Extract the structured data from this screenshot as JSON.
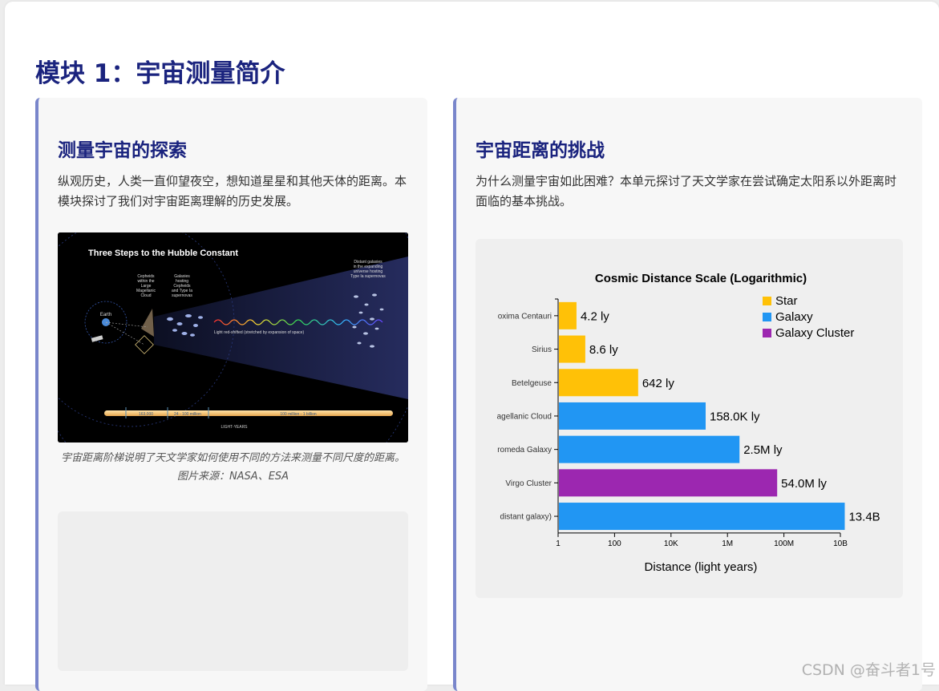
{
  "page": {
    "title": "模块 1：宇宙测量简介"
  },
  "left_card": {
    "title": "测量宇宙的探索",
    "text": "纵观历史，人类一直仰望夜空，想知道星星和其他天体的距离。本模块探讨了我们对宇宙距离理解的历史发展。",
    "image": {
      "heading": "Three Steps to the Hubble Constant",
      "label_earth": "Earth",
      "label_cepheids": [
        "Cepheids",
        "within the",
        "Large",
        "Magellanic",
        "Cloud"
      ],
      "label_galaxies": [
        "Galaxies",
        "hosting",
        "Cepheids",
        "and Type Ia",
        "supernovas"
      ],
      "label_distant": [
        "Distant galaxies",
        "in the expanding",
        "universe hosting",
        "Type Ia supernovas"
      ],
      "label_redshift": "Light red-shifted (stretched by expansion of space)",
      "scale_1": "163,000",
      "scale_2": "24 - 100 million",
      "scale_3": "100 million - 1 billion",
      "scale_units": "LIGHT-YEARS",
      "colors": {
        "background": "#000000",
        "beam": "#1f2553",
        "scale_bar": "#f3c27a"
      }
    },
    "caption": "宇宙距离阶梯说明了天文学家如何使用不同的方法来测量不同尺度的距离。图片来源：NASA、ESA"
  },
  "right_card": {
    "title": "宇宙距离的挑战",
    "text": "为什么测量宇宙如此困难？本单元探讨了天文学家在尝试确定太阳系以外距离时面临的基本挑战。"
  },
  "chart_data": {
    "type": "bar",
    "orientation": "horizontal",
    "title": "Cosmic Distance Scale (Logarithmic)",
    "xlabel": "Distance (light years)",
    "ylabel": "",
    "x_scale": "log",
    "xlim": [
      1,
      10000000000
    ],
    "x_ticks": [
      1,
      100,
      10000,
      1000000,
      100000000,
      10000000000
    ],
    "x_tick_labels": [
      "1",
      "100",
      "10K",
      "1M",
      "100M",
      "10B"
    ],
    "legend_position": "top-right",
    "legend": [
      {
        "name": "Star",
        "color": "#ffc107"
      },
      {
        "name": "Galaxy",
        "color": "#2196f3"
      },
      {
        "name": "Galaxy Cluster",
        "color": "#9c27b0"
      }
    ],
    "categories": [
      "oxima Centauri",
      "Sirius",
      "Betelgeuse",
      "agellanic Cloud",
      "romeda Galaxy",
      "Virgo Cluster",
      "distant galaxy)"
    ],
    "values": [
      4.2,
      8.6,
      642,
      158000,
      2500000,
      54000000,
      13400000000
    ],
    "value_labels": [
      "4.2 ly",
      "8.6 ly",
      "642 ly",
      "158.0K ly",
      "2.5M ly",
      "54.0M ly",
      "13.4B"
    ],
    "types": [
      "Star",
      "Star",
      "Star",
      "Galaxy",
      "Galaxy",
      "Galaxy Cluster",
      "Galaxy"
    ],
    "grid": false
  },
  "watermark": "CSDN @奋斗者1号"
}
